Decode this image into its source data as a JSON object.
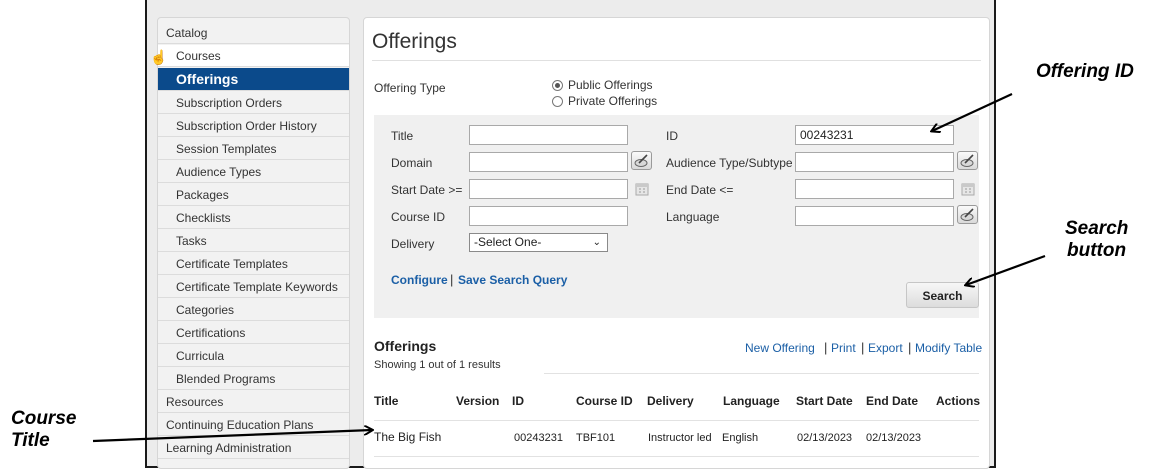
{
  "sidebar": {
    "items": [
      {
        "label": "Catalog",
        "level": "top"
      },
      {
        "label": "Courses",
        "level": "sub"
      },
      {
        "label": "Offerings",
        "level": "sub",
        "active": true
      },
      {
        "label": "Subscription Orders",
        "level": "sub"
      },
      {
        "label": "Subscription Order History",
        "level": "sub"
      },
      {
        "label": "Session Templates",
        "level": "sub"
      },
      {
        "label": "Audience Types",
        "level": "sub"
      },
      {
        "label": "Packages",
        "level": "sub"
      },
      {
        "label": "Checklists",
        "level": "sub"
      },
      {
        "label": "Tasks",
        "level": "sub"
      },
      {
        "label": "Certificate Templates",
        "level": "sub"
      },
      {
        "label": "Certificate Template Keywords",
        "level": "sub"
      },
      {
        "label": "Categories",
        "level": "sub"
      },
      {
        "label": "Certifications",
        "level": "sub"
      },
      {
        "label": "Curricula",
        "level": "sub"
      },
      {
        "label": "Blended Programs",
        "level": "sub"
      },
      {
        "label": "Resources",
        "level": "top"
      },
      {
        "label": "Continuing Education Plans",
        "level": "top"
      },
      {
        "label": "Learning Administration",
        "level": "top"
      }
    ]
  },
  "main": {
    "title": "Offerings",
    "offering_type_label": "Offering Type",
    "radio_public": "Public Offerings",
    "radio_private": "Private Offerings",
    "selected_radio": "Public Offerings"
  },
  "search": {
    "title_label": "Title",
    "title_value": "",
    "id_label": "ID",
    "id_value": "00243231",
    "domain_label": "Domain",
    "domain_value": "",
    "audience_label": "Audience Type/Subtype",
    "audience_value": "",
    "start_label": "Start Date >=",
    "start_value": "",
    "end_label": "End Date <=",
    "end_value": "",
    "course_id_label": "Course ID",
    "course_id_value": "",
    "language_label": "Language",
    "language_value": "",
    "delivery_label": "Delivery",
    "delivery_value": "-Select One-",
    "configure_link": "Configure",
    "save_query_link": "Save Search Query",
    "search_button": "Search"
  },
  "results": {
    "title": "Offerings",
    "showing": "Showing 1 out of 1 results",
    "actions": [
      "New Offering",
      "Print",
      "Export",
      "Modify Table"
    ],
    "columns": [
      "Title",
      "Version",
      "ID",
      "Course ID",
      "Delivery",
      "Language",
      "Start Date",
      "End Date",
      "Actions"
    ],
    "rows": [
      {
        "title": "The Big Fish",
        "version": "",
        "id": "00243231",
        "course_id": "TBF101",
        "delivery": "Instructor led",
        "language": "English",
        "start_date": "02/13/2023",
        "end_date": "02/13/2023",
        "actions": ""
      }
    ]
  },
  "annotations": {
    "offering_id": "Offering ID",
    "search_button_1": "Search",
    "search_button_2": "button",
    "course_title_1": "Course",
    "course_title_2": "Title"
  },
  "colors": {
    "active_nav": "#0b4a8b",
    "link": "#1b5fa6",
    "panel": "#f0f0f0"
  }
}
